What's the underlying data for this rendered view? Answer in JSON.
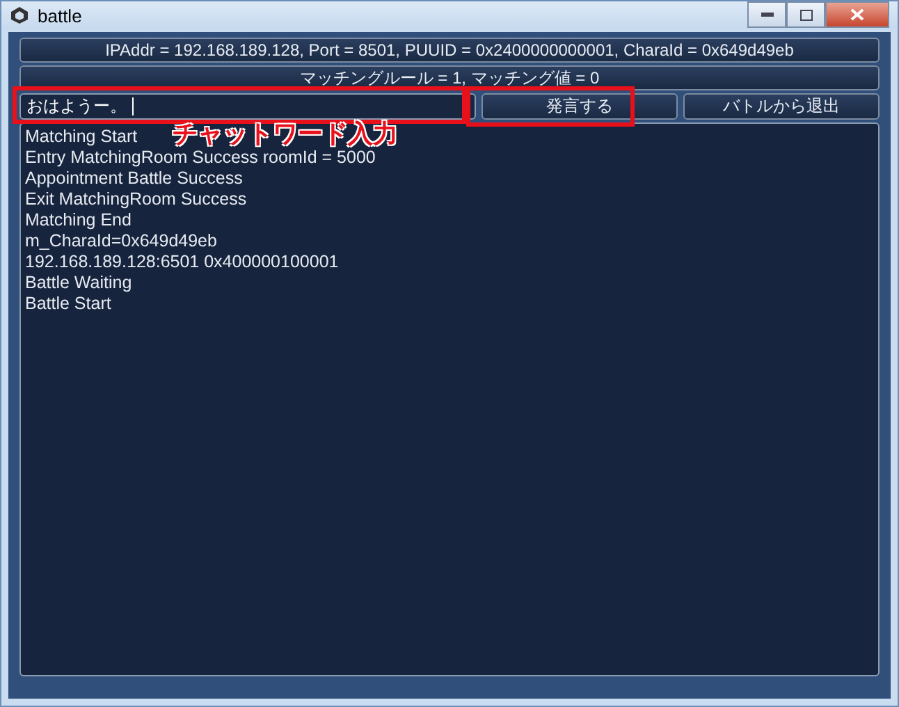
{
  "window": {
    "title": "battle"
  },
  "info_bar": "IPAddr = 192.168.189.128, Port = 8501, PUUID = 0x2400000000001, CharaId = 0x649d49eb",
  "rule_bar": "マッチングルール = 1, マッチング値 = 0",
  "chat_input": {
    "value": "おはようー。"
  },
  "buttons": [
    "発言する",
    "バトルから退出"
  ],
  "log": [
    "Matching Start",
    "Entry MatchingRoom Success roomId = 5000",
    "Appointment Battle Success",
    "Exit MatchingRoom Success",
    "Matching End",
    "m_CharaId=0x649d49eb",
    "192.168.189.128:6501 0x400000100001",
    "Battle Waiting",
    "Battle Start"
  ],
  "annotation": {
    "label": "チャットワード入力"
  }
}
